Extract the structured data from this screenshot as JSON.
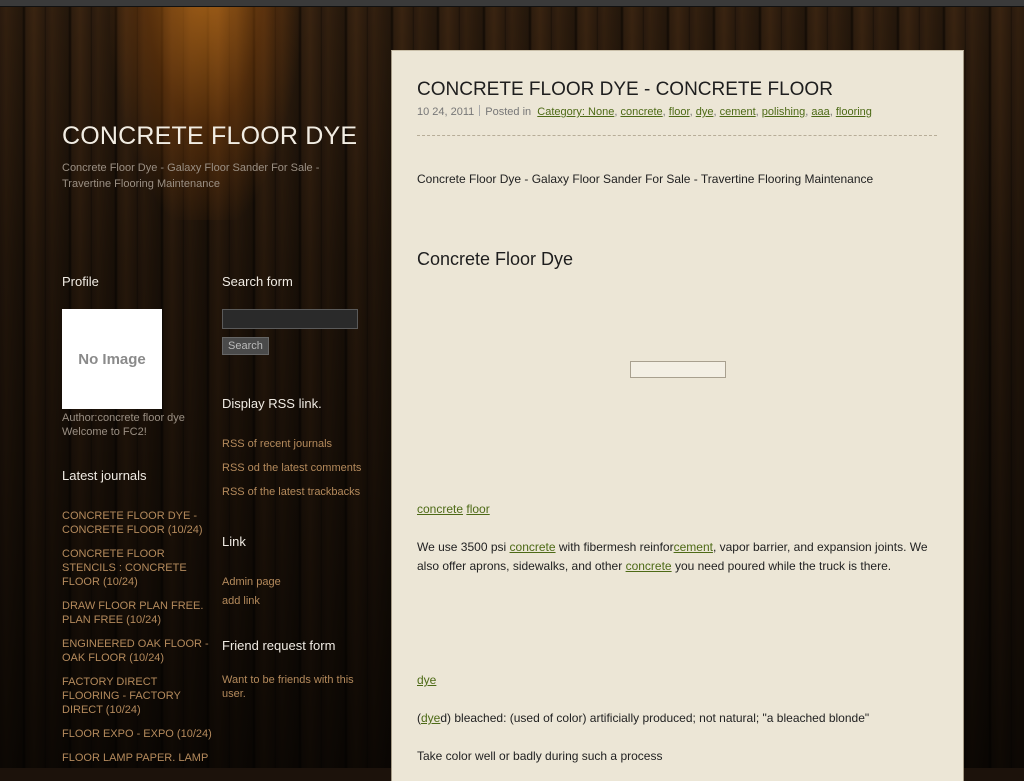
{
  "site": {
    "title": "CONCRETE FLOOR DYE",
    "description": "Concrete Floor Dye - Galaxy Floor Sander For Sale - Travertine Flooring Maintenance"
  },
  "profile": {
    "heading": "Profile",
    "image_text": "No Image",
    "author": "Author:concrete floor dye",
    "welcome": "Welcome to FC2!"
  },
  "latest": {
    "heading": "Latest journals",
    "items": [
      "CONCRETE FLOOR DYE - CONCRETE FLOOR (10/24)",
      "CONCRETE FLOOR STENCILS : CONCRETE FLOOR (10/24)",
      "DRAW FLOOR PLAN FREE. PLAN FREE (10/24)",
      "ENGINEERED OAK FLOOR - OAK FLOOR (10/24)",
      "FACTORY DIRECT FLOORING - FACTORY DIRECT (10/24)",
      "FLOOR EXPO - EXPO (10/24)",
      "FLOOR LAMP PAPER. LAMP"
    ]
  },
  "search": {
    "heading": "Search form",
    "placeholder": "",
    "button": "Search"
  },
  "rss": {
    "heading": "Display RSS link.",
    "items": [
      "RSS of recent journals",
      "RSS od the latest comments",
      "RSS of the latest trackbacks"
    ]
  },
  "link": {
    "heading": "Link",
    "items": [
      "Admin page",
      "add link"
    ]
  },
  "friend": {
    "heading": "Friend request form",
    "text": "Want to be friends with this user."
  },
  "entry": {
    "title": "CONCRETE FLOOR DYE - CONCRETE FLOOR",
    "date": "10 24, 2011",
    "posted_in": "Posted in",
    "tags": [
      "Category: None",
      "concrete",
      "floor",
      "dye",
      "cement",
      "polishing",
      "aaa",
      "flooring"
    ],
    "intro": "Concrete Floor Dye - Galaxy Floor Sander For Sale - Travertine Flooring Maintenance",
    "subheading": "Concrete Floor Dye",
    "link_concrete": "concrete",
    "link_floor": "floor",
    "para1_a": "We use 3500 psi ",
    "para1_link1": "concrete",
    "para1_b": " with fibermesh reinfor",
    "para1_link2": "cement",
    "para1_c": ", vapor barrier, and expansion joints.  We also offer aprons, sidewalks, and other ",
    "para1_link3": "concrete",
    "para1_d": " you need poured while the truck is there.",
    "link_dye": "dye",
    "para2_a": "(",
    "para2_link": "dye",
    "para2_b": "d) bleached: (used of color) artificially produced; not natural; \"a bleached blonde\"",
    "para3": "Take color well or badly during such a process"
  }
}
